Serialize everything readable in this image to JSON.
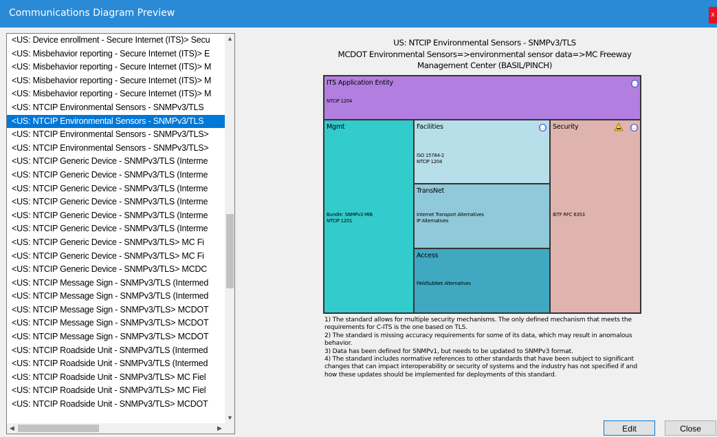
{
  "window": {
    "title": "Communications Diagram Preview",
    "close_label": "x"
  },
  "list": {
    "items": [
      "<US: Device enrollment - Secure Internet (ITS)> Secu",
      "<US: Misbehavior reporting - Secure Internet (ITS)> E",
      "<US: Misbehavior reporting - Secure Internet (ITS)> M",
      "<US: Misbehavior reporting - Secure Internet (ITS)> M",
      "<US: Misbehavior reporting - Secure Internet (ITS)> M",
      "<US: NTCIP Environmental Sensors - SNMPv3/TLS",
      "<US: NTCIP Environmental Sensors - SNMPv3/TLS",
      "<US: NTCIP Environmental Sensors - SNMPv3/TLS>",
      "<US: NTCIP Environmental Sensors - SNMPv3/TLS>",
      "<US: NTCIP Generic Device - SNMPv3/TLS (Interme",
      "<US: NTCIP Generic Device - SNMPv3/TLS (Interme",
      "<US: NTCIP Generic Device - SNMPv3/TLS (Interme",
      "<US: NTCIP Generic Device - SNMPv3/TLS (Interme",
      "<US: NTCIP Generic Device - SNMPv3/TLS (Interme",
      "<US: NTCIP Generic Device - SNMPv3/TLS (Interme",
      "<US: NTCIP Generic Device - SNMPv3/TLS> MC Fi",
      "<US: NTCIP Generic Device - SNMPv3/TLS> MC Fi",
      "<US: NTCIP Generic Device - SNMPv3/TLS> MCDC",
      "<US: NTCIP Message Sign - SNMPv3/TLS (Intermed",
      "<US: NTCIP Message Sign - SNMPv3/TLS (Intermed",
      "<US: NTCIP Message Sign - SNMPv3/TLS> MCDOT",
      "<US: NTCIP Message Sign - SNMPv3/TLS> MCDOT",
      "<US: NTCIP Message Sign - SNMPv3/TLS> MCDOT",
      "<US: NTCIP Roadside Unit - SNMPv3/TLS (Intermed",
      "<US: NTCIP Roadside Unit - SNMPv3/TLS (Intermed",
      "<US: NTCIP Roadside Unit - SNMPv3/TLS> MC Fiel",
      "<US: NTCIP Roadside Unit - SNMPv3/TLS> MC Fiel",
      "<US: NTCIP Roadside Unit - SNMPv3/TLS> MCDOT"
    ],
    "selected_index": 6
  },
  "diagram": {
    "title_line1": "US: NTCIP Environmental Sensors - SNMPv3/TLS",
    "title_line2": "MCDOT Environmental Sensors=>environmental sensor data=>MC Freeway",
    "title_line3": "Management Center (BASIL/PINCH)",
    "layers": {
      "its_app": {
        "name": "ITS Application Entity",
        "std": "NTCIP 1204",
        "color": "#b27fe0"
      },
      "mgmt": {
        "name": "Mgmt",
        "std1": "Bundle: SNMPv3 MIB",
        "std2": "NTCIP 1201",
        "color": "#33cccc"
      },
      "facilities": {
        "name": "Facilities",
        "std1": "ISO 15784-2",
        "std2": "NTCIP 1204",
        "color": "#b7dfea"
      },
      "transnet": {
        "name": "TransNet",
        "std1": "Internet Transport Alternatives",
        "std2": "IP Alternatives",
        "color": "#90c9d9"
      },
      "access": {
        "name": "Access",
        "std": "FieldSubNet Alternatives",
        "color": "#40a8c0"
      },
      "security": {
        "name": "Security",
        "std": "IETF RFC 6353",
        "color": "#e0b4ae"
      }
    },
    "icon_glyph": "(...)",
    "notes": [
      "1) The standard allows for multiple security mechanisms. The only defined mechanism that meets the requirements for C-ITS is the one based on TLS.",
      "2) The standard is missing accuracy requirements for some of its data, which may result in anomalous behavior.",
      "3) Data has been defined for SNMPv1, but needs to be updated to SNMPv3 format.",
      "4) The standard includes normative references to other standards that have been subject to significant changes that can impact interoperability or security of systems and the industry has not specified if and how these updates should be implemented for deployments of this standard."
    ]
  },
  "buttons": {
    "edit": "Edit",
    "close": "Close"
  }
}
